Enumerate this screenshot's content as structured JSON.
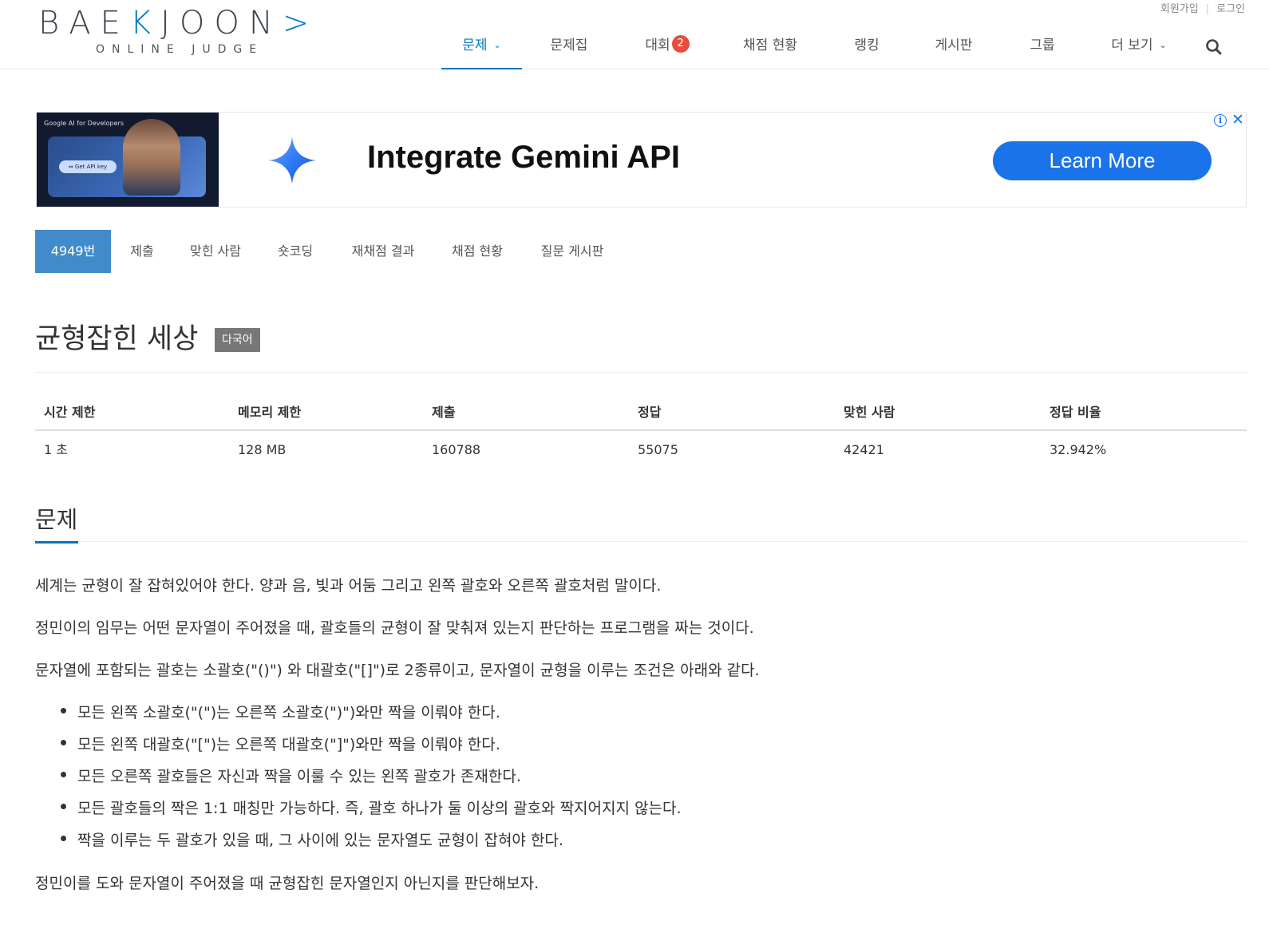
{
  "header": {
    "logo_main_1": "BAE",
    "logo_main_accent": "K",
    "logo_main_2": "JOON",
    "logo_main_accent2": ">",
    "logo_sub": "ONLINE JUDGE",
    "top_links": [
      "회원가입",
      "로그인"
    ],
    "nav": [
      {
        "label": "문제",
        "caret": true
      },
      {
        "label": "문제집"
      },
      {
        "label": "대회",
        "badge": "2"
      },
      {
        "label": "채점 현황"
      },
      {
        "label": "랭킹"
      },
      {
        "label": "게시판"
      },
      {
        "label": "그룹"
      },
      {
        "label": "더 보기",
        "caret": true
      }
    ],
    "search_icon": "search-icon",
    "accent_color": "#0076c0"
  },
  "ad": {
    "thumb_label": "Google AI for Developers",
    "thumb_button": "⇔ Get API key",
    "headline": "Integrate Gemini API",
    "cta": "Learn More",
    "info_icon": "info-icon",
    "close_icon": "close-icon",
    "cta_color": "#1a73e8"
  },
  "problem_tabs": [
    "4949번",
    "제출",
    "맞힌 사람",
    "숏코딩",
    "재채점 결과",
    "채점 현황",
    "질문 게시판"
  ],
  "problem": {
    "title": "균형잡힌 세상",
    "label": "다국어",
    "info_headers": [
      "시간 제한",
      "메모리 제한",
      "제출",
      "정답",
      "맞힌 사람",
      "정답 비율"
    ],
    "info_values": [
      "1 초",
      "128 MB",
      "160788",
      "55075",
      "42421",
      "32.942%"
    ],
    "section_title": "문제",
    "paragraphs": [
      "세계는 균형이 잘 잡혀있어야 한다. 양과 음, 빛과 어둠 그리고 왼쪽 괄호와 오른쪽 괄호처럼 말이다.",
      "정민이의 임무는 어떤 문자열이 주어졌을 때, 괄호들의 균형이 잘 맞춰져 있는지 판단하는 프로그램을 짜는 것이다.",
      "문자열에 포함되는 괄호는 소괄호(\"()\") 와 대괄호(\"[]\")로 2종류이고, 문자열이 균형을 이루는 조건은 아래와 같다."
    ],
    "bullets": [
      "모든 왼쪽 소괄호(\"(\")는 오른쪽 소괄호(\")\")와만 짝을 이뤄야 한다.",
      "모든 왼쪽 대괄호(\"[\")는 오른쪽 대괄호(\"]\")와만 짝을 이뤄야 한다.",
      "모든 오른쪽 괄호들은 자신과 짝을 이룰 수 있는 왼쪽 괄호가 존재한다.",
      "모든 괄호들의 짝은 1:1 매칭만 가능하다. 즉, 괄호 하나가 둘 이상의 괄호와 짝지어지지 않는다.",
      "짝을 이루는 두 괄호가 있을 때, 그 사이에 있는 문자열도 균형이 잡혀야 한다."
    ],
    "closing": "정민이를 도와 문자열이 주어졌을 때 균형잡힌 문자열인지 아닌지를 판단해보자."
  }
}
